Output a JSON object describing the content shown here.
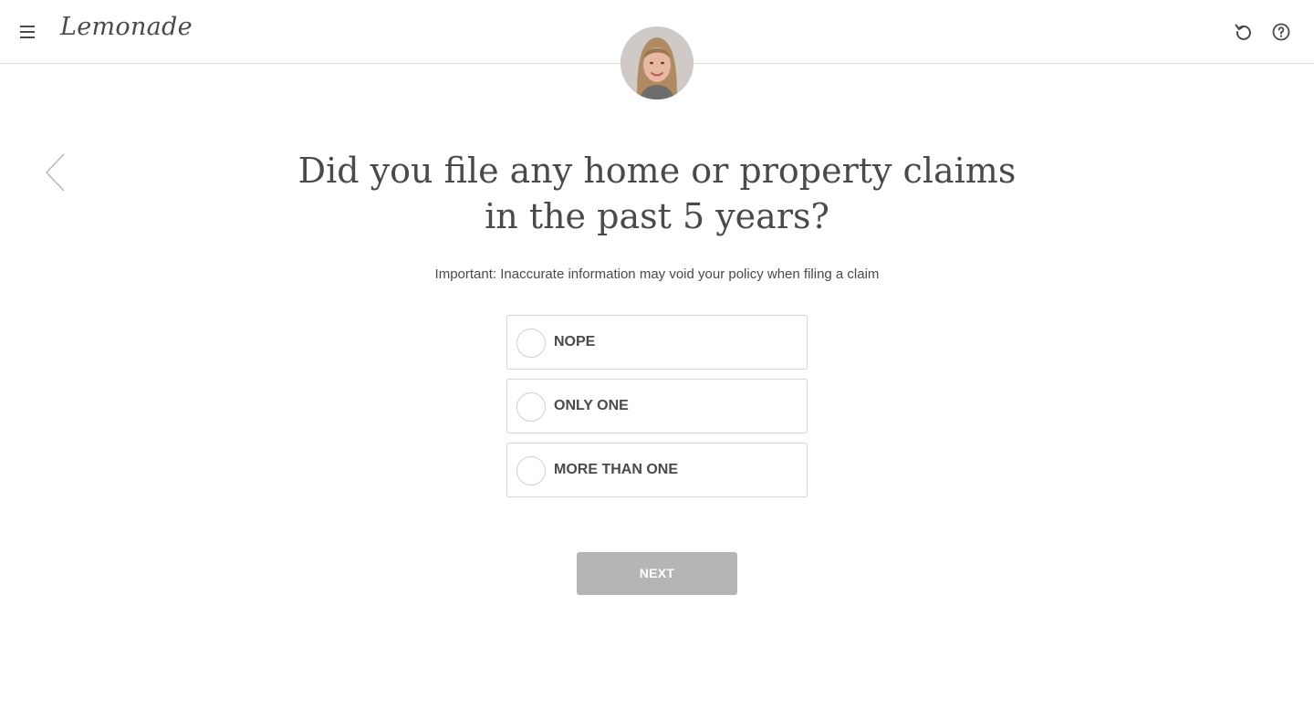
{
  "header": {
    "logo_text": "Lemonade",
    "menu_icon": "hamburger-menu-icon",
    "restart_icon": "restart-icon",
    "help_icon": "question-mark-icon"
  },
  "avatar": {
    "icon": "agent-avatar-photo"
  },
  "back": {
    "icon": "chevron-left-icon"
  },
  "main": {
    "question": "Did you file any home or property claims in the past 5 years?",
    "subtitle": "Important: Inaccurate information may void your policy when filing a claim",
    "options": [
      {
        "label": "NOPE"
      },
      {
        "label": "ONLY ONE"
      },
      {
        "label": "MORE THAN ONE"
      }
    ],
    "next_label": "NEXT"
  },
  "colors": {
    "text": "#4a4a4a",
    "border": "#d6d6d6",
    "button_disabled": "#b5b5b5"
  }
}
